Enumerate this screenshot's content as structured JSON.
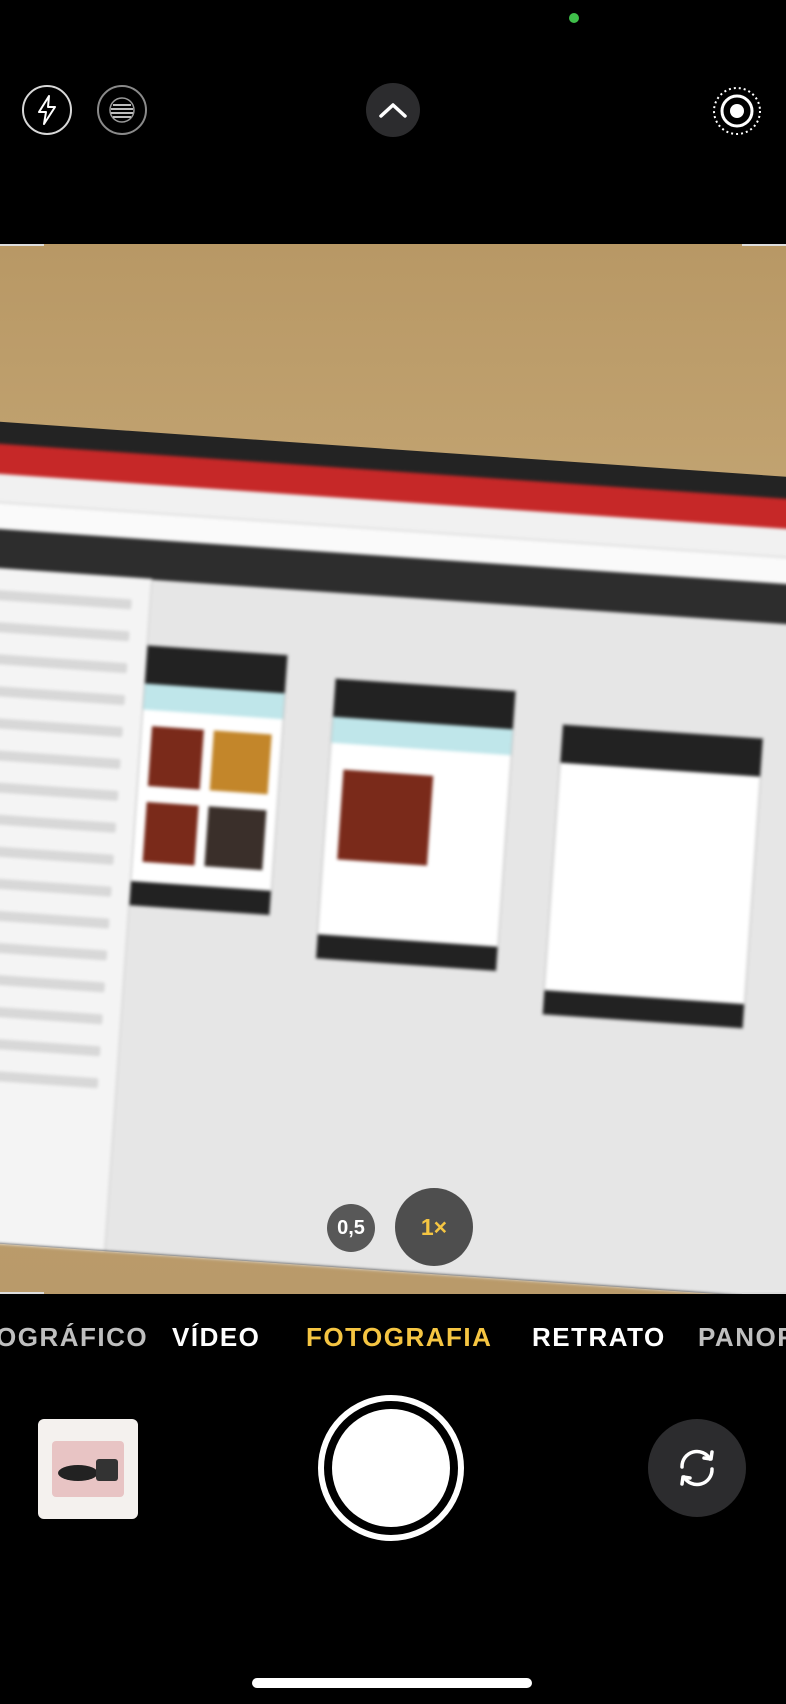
{
  "zoom": {
    "ultrawide": "0,5",
    "wide": "1×"
  },
  "modes": [
    "OGRÁFICO",
    "VÍDEO",
    "FOTOGRAFIA",
    "RETRATO",
    "PANORA"
  ],
  "active_mode": "FOTOGRAFIA",
  "colors": {
    "accent": "#f5c542",
    "privacy_dot": "#3fbf4a",
    "background": "#000000"
  },
  "icons": {
    "flash": "flash-icon",
    "exposure": "exposure-icon",
    "chevron": "chevron-up-icon",
    "live": "live-photo-icon",
    "flip": "camera-flip-icon"
  }
}
